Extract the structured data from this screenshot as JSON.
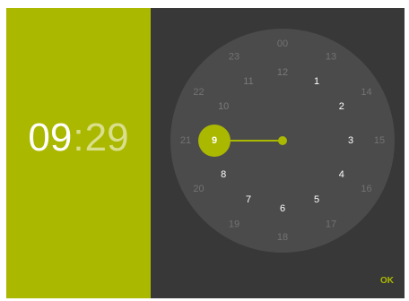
{
  "header": {
    "hours": "09",
    "separator": ":",
    "minutes": "29"
  },
  "clock": {
    "selected": "9",
    "inner_hours": [
      "00",
      "13",
      "14",
      "15",
      "16",
      "17",
      "18",
      "19",
      "20",
      "21",
      "22",
      "23"
    ],
    "outer_hours": [
      "12",
      "1",
      "2",
      "3",
      "4",
      "5",
      "6",
      "7",
      "8",
      "9",
      "10",
      "11"
    ]
  },
  "actions": {
    "ok_label": "OK"
  },
  "colors": {
    "accent": "#abb800",
    "dial": "#4b4b4b",
    "background": "#383838"
  }
}
